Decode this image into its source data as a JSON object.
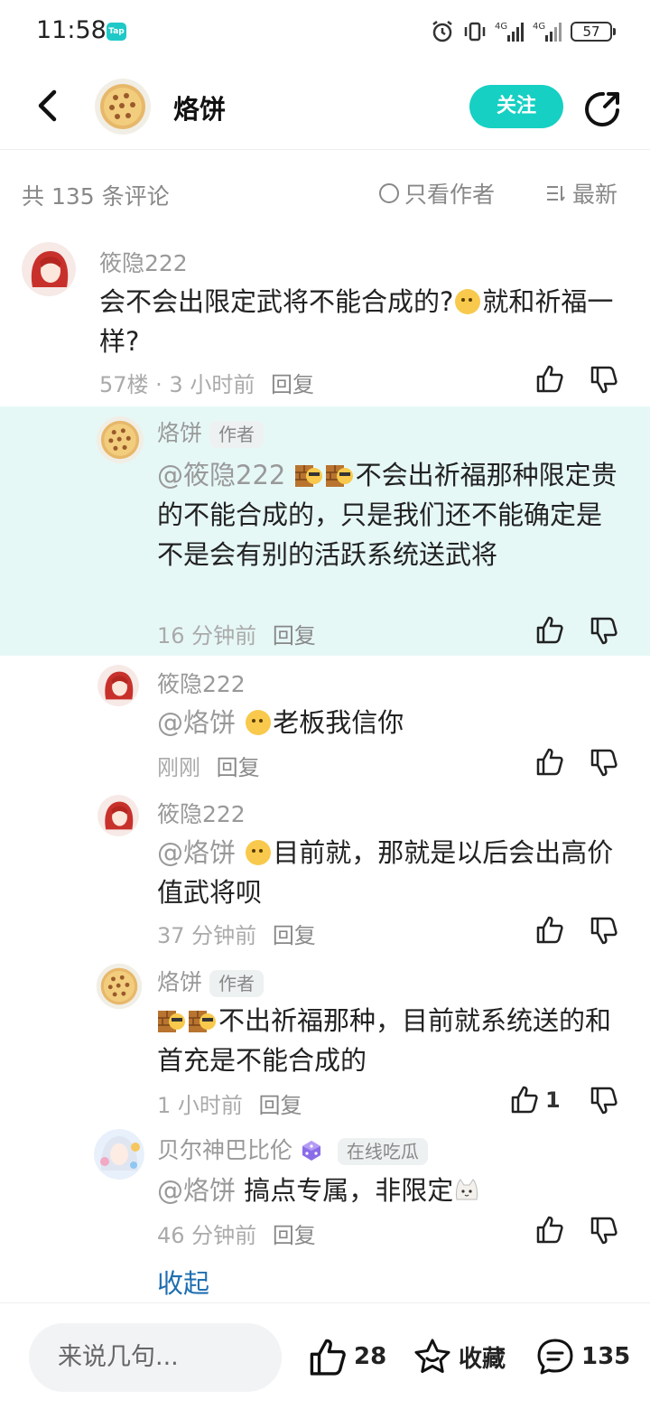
{
  "status_bar": {
    "time": "11:58",
    "app_badge": "Tap",
    "battery": "57"
  },
  "header": {
    "title": "烙饼",
    "follow_label": "关注"
  },
  "filter": {
    "total": "共 135 条评论",
    "author_only": "只看作者",
    "sort": "最新"
  },
  "main_comment": {
    "username": "筱隐222",
    "text_a": "会不会出限定武将不能合成的?",
    "text_b": "就和祈福一样?",
    "floor": "57楼 · 3 小时前",
    "reply": "回复"
  },
  "replies": [
    {
      "username": "烙饼",
      "author_tag": "作者",
      "mention": "@筱隐222",
      "text": "不会出祈福那种限定贵的不能合成的，只是我们还不能确定是不是会有别的活跃系统送武将",
      "time": "16 分钟前",
      "reply": "回复"
    },
    {
      "username": "筱隐222",
      "mention": "@烙饼",
      "text": "老板我信你",
      "time": "刚刚",
      "reply": "回复"
    },
    {
      "username": "筱隐222",
      "mention": "@烙饼",
      "text": "目前就，那就是以后会出高价值武将呗",
      "time": "37 分钟前",
      "reply": "回复"
    },
    {
      "username": "烙饼",
      "author_tag": "作者",
      "text": "不出祈福那种，目前就系统送的和首充是不能合成的",
      "time": "1 小时前",
      "reply": "回复",
      "likes": "1"
    },
    {
      "username": "贝尔神巴比伦",
      "badge": "在线吃瓜",
      "mention": "@烙饼",
      "text": "搞点专属，非限定",
      "time": "46 分钟前",
      "reply": "回复"
    }
  ],
  "collapse_label": "收起",
  "bottom_bar": {
    "input_placeholder": "来说几句...",
    "likes": "28",
    "favorite_label": "收藏",
    "comments": "135"
  },
  "colors": {
    "accent": "#16d0c3",
    "highlight_bg": "#e6f8f6",
    "link": "#1f6fb0"
  }
}
